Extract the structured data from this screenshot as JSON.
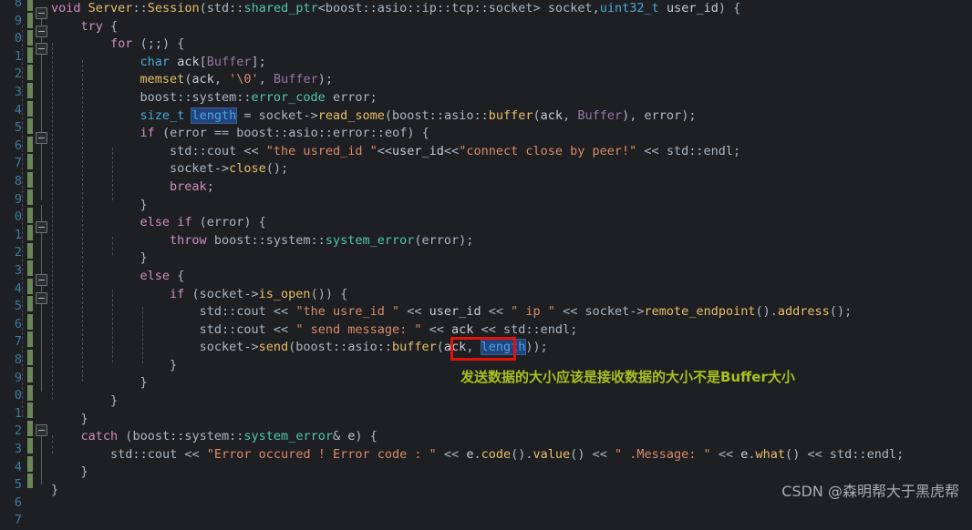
{
  "editor": {
    "background": "#1e1f22",
    "line_number_color": "#3b7ba4",
    "change_bar_color": "#6a8759",
    "selection_color": "#214283",
    "annotation_box_color": "#e3120b",
    "annotation_text_color": "#a8c020"
  },
  "line_numbers": [
    "8",
    "9",
    "0",
    "1",
    "2",
    "3",
    "4",
    "5",
    "6",
    "7",
    "8",
    "9",
    "0",
    "1",
    "2",
    "3",
    "4",
    "5",
    "6",
    "7",
    "8",
    "9",
    "0",
    "1",
    "2",
    "3",
    "4",
    "5",
    "6",
    "7"
  ],
  "code_lines": [
    "void Server::Session(std::shared_ptr<boost::asio::ip::tcp::socket> socket,uint32_t user_id) {",
    "    try {",
    "        for (;;) {",
    "            char ack[Buffer];",
    "            memset(ack, '\\0', Buffer);",
    "            boost::system::error_code error;",
    "            size_t length = socket->read_some(boost::asio::buffer(ack, Buffer), error);",
    "            if (error == boost::asio::error::eof) {",
    "                std::cout << \"the usred_id \"<<user_id<<\"connect close by peer!\" << std::endl;",
    "                socket->close();",
    "                break;",
    "            }",
    "            else if (error) {",
    "                throw boost::system::system_error(error);",
    "            }",
    "            else {",
    "                if (socket->is_open()) {",
    "                    std::cout << \"the usre_id \" << user_id << \" ip \" << socket->remote_endpoint().address();",
    "                    std::cout << \" send message: \" << ack << std::endl;",
    "                    socket->send(boost::asio::buffer(ack, length));",
    "                }",
    "            }",
    "        }",
    "    }",
    "    catch (boost::system::system_error& e) {",
    "        std::cout << \"Error occured ! Error code : \" << e.code().value() << \" .Message: \" << e.what() << std::endl;",
    "    }",
    "}"
  ],
  "selected_token": "length",
  "annotation": {
    "note_text": "发送数据的大小应该是接收数据的大小不是Buffer大小",
    "boxed_token": "length))"
  },
  "watermark": {
    "text": "CSDN @森明帮大于黑虎帮"
  }
}
